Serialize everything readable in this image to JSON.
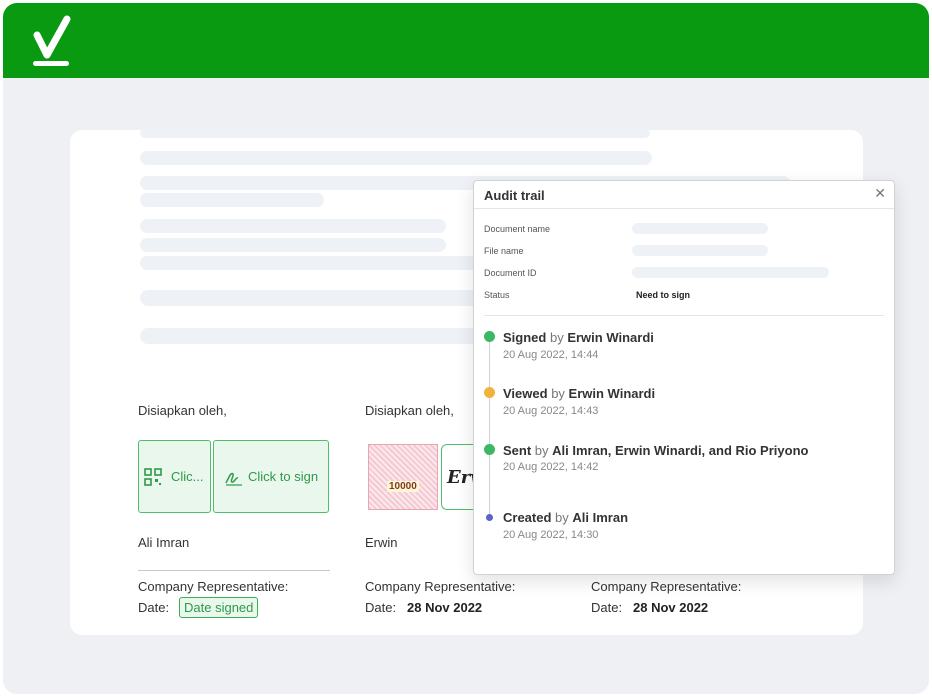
{
  "header": {
    "logo_icon": "checkmark-logo-icon",
    "color": "#0a9a12"
  },
  "document": {
    "signers": [
      {
        "prepared_label": "Disiapkan oleh,",
        "name": "Ali Imran",
        "role": "Company Representative:",
        "date_label": "Date:",
        "date_value": "Date signed",
        "buttons": [
          {
            "label": "Clic...",
            "icon": "qr-code-icon"
          },
          {
            "label": "Click to sign",
            "icon": "signature-pen-icon"
          }
        ]
      },
      {
        "prepared_label": "Disiapkan oleh,",
        "name": "Erwin",
        "role": "Company Representative:",
        "date_label": "Date:",
        "date_value": "28 Nov 2022",
        "stamp_text": "10000",
        "signature_text": "Erw"
      },
      {
        "role": "Company Representative:",
        "date_label": "Date:",
        "date_value": "28 Nov 2022"
      }
    ]
  },
  "audit": {
    "title": "Audit trail",
    "close_icon": "close-icon",
    "fields": [
      {
        "label": "Document name",
        "value": ""
      },
      {
        "label": "File name",
        "value": ""
      },
      {
        "label": "Document ID",
        "value": ""
      },
      {
        "label": "Status",
        "value": "Need to sign"
      }
    ],
    "events": [
      {
        "action": "Signed",
        "by": "by",
        "actor": "Erwin Winardi",
        "time": "20 Aug 2022, 14:44",
        "color": "#3db764"
      },
      {
        "action": "Viewed",
        "by": "by",
        "actor": "Erwin Winardi",
        "time": "20 Aug 2022, 14:43",
        "color": "#f0b43c"
      },
      {
        "action": "Sent",
        "by": "by",
        "actor": "Ali Imran, Erwin Winardi, and Rio Priyono",
        "time": "20 Aug 2022, 14:42",
        "color": "#3db764"
      },
      {
        "action": "Created",
        "by": "by",
        "actor": "Ali Imran",
        "time": "20 Aug 2022, 14:30",
        "color": "#5b63c9"
      }
    ]
  }
}
